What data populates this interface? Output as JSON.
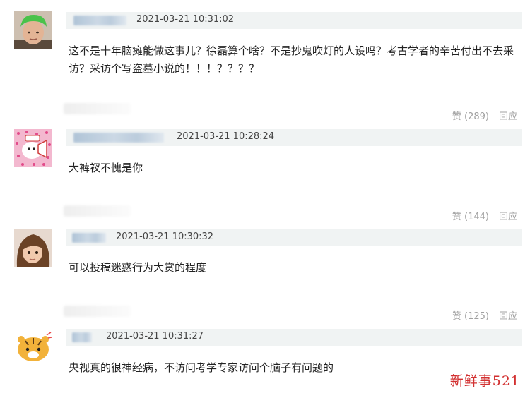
{
  "comments": [
    {
      "timestamp": "2021-03-21 10:31:02",
      "text": "这不是十年脑瘫能做这事儿？徐磊算个啥？不是抄鬼吹灯的人设吗？考古学者的辛苦付出不去采访？采访个写盗墓小说的！！！？？？？",
      "likes": "赞 (289)",
      "reply": "回应"
    },
    {
      "timestamp": "2021-03-21 10:28:24",
      "text": "大裤衩不愧是你",
      "likes": "赞 (144)",
      "reply": "回应"
    },
    {
      "timestamp": "2021-03-21 10:30:32",
      "text": "可以投稿迷惑行为大赏的程度",
      "likes": "赞 (125)",
      "reply": "回应"
    },
    {
      "timestamp": "2021-03-21 10:31:27",
      "text": "央视真的很神经病，不访问考学专家访问个脑子有问题的"
    }
  ],
  "watermark": "新鲜事521",
  "colors": {
    "meta_bar": "#f0f3f3",
    "action_text": "#a0a0a0",
    "watermark": "#d23030"
  },
  "icons": [
    "avatar-green-hair",
    "avatar-sticker-pink",
    "avatar-child-photo",
    "avatar-cartoon-tiger"
  ]
}
